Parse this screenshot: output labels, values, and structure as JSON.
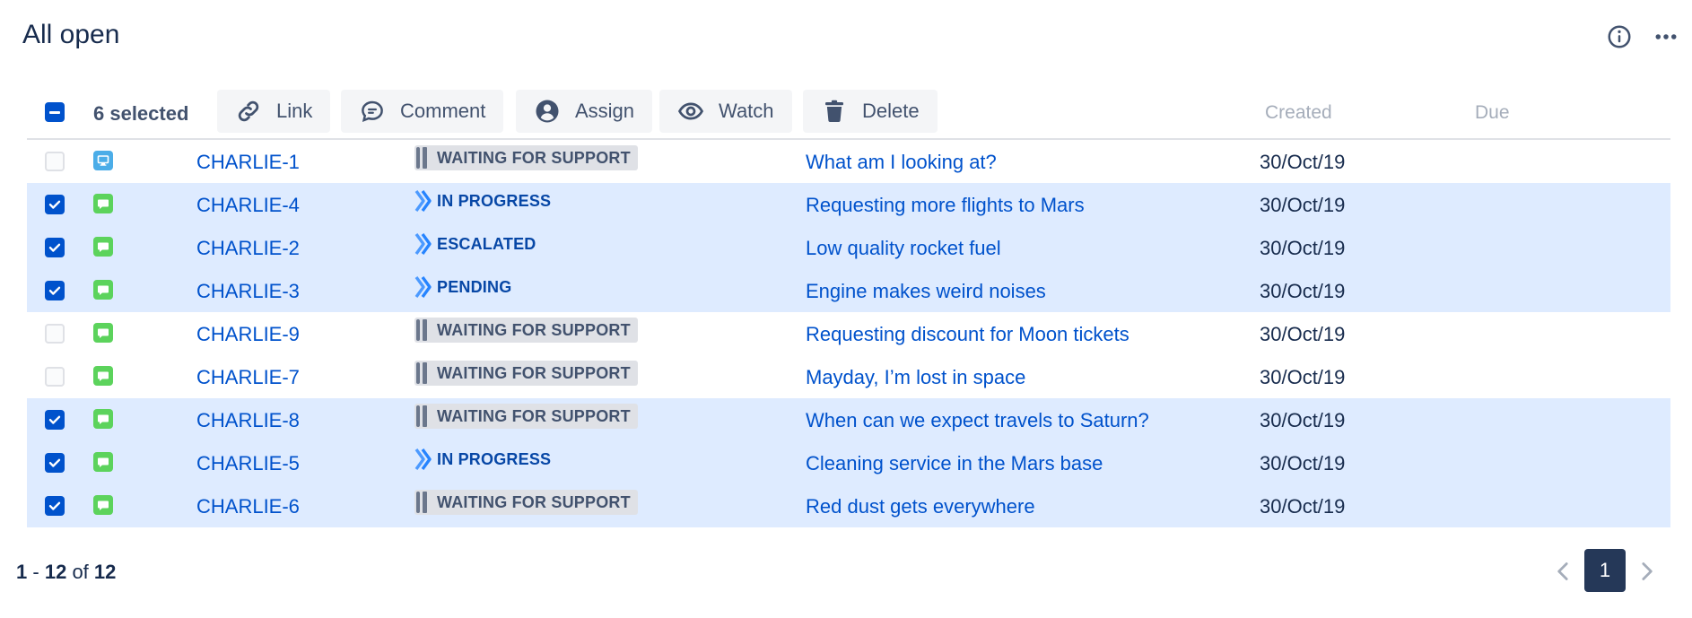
{
  "page": {
    "title": "All open"
  },
  "toolbar": {
    "selected_label": "6 selected",
    "buttons": [
      {
        "label": "Link",
        "icon": "link-icon"
      },
      {
        "label": "Comment",
        "icon": "comment-icon"
      },
      {
        "label": "Assign",
        "icon": "person-icon"
      },
      {
        "label": "Watch",
        "icon": "eye-icon"
      },
      {
        "label": "Delete",
        "icon": "trash-icon"
      }
    ],
    "columns": {
      "created": "Created",
      "due": "Due"
    }
  },
  "rows": [
    {
      "selected": false,
      "type": "change",
      "key": "CHARLIE-1",
      "status": "WAITING FOR SUPPORT",
      "status_style": "gray",
      "summary": "What am I looking at?",
      "created": "30/Oct/19"
    },
    {
      "selected": true,
      "type": "service",
      "key": "CHARLIE-4",
      "status": "IN PROGRESS",
      "status_style": "blue",
      "summary": "Requesting more flights to Mars",
      "created": "30/Oct/19"
    },
    {
      "selected": true,
      "type": "service",
      "key": "CHARLIE-2",
      "status": "ESCALATED",
      "status_style": "blue",
      "summary": "Low quality rocket fuel",
      "created": "30/Oct/19"
    },
    {
      "selected": true,
      "type": "service",
      "key": "CHARLIE-3",
      "status": "PENDING",
      "status_style": "blue",
      "summary": "Engine makes weird noises",
      "created": "30/Oct/19"
    },
    {
      "selected": false,
      "type": "service",
      "key": "CHARLIE-9",
      "status": "WAITING FOR SUPPORT",
      "status_style": "gray",
      "summary": "Requesting discount for Moon tickets",
      "created": "30/Oct/19"
    },
    {
      "selected": false,
      "type": "service",
      "key": "CHARLIE-7",
      "status": "WAITING FOR SUPPORT",
      "status_style": "gray",
      "summary": "Mayday, I’m lost in space",
      "created": "30/Oct/19"
    },
    {
      "selected": true,
      "type": "service",
      "key": "CHARLIE-8",
      "status": "WAITING FOR SUPPORT",
      "status_style": "gray",
      "summary": "When can we expect travels to Saturn?",
      "created": "30/Oct/19"
    },
    {
      "selected": true,
      "type": "service",
      "key": "CHARLIE-5",
      "status": "IN PROGRESS",
      "status_style": "blue",
      "summary": "Cleaning service in the Mars base",
      "created": "30/Oct/19"
    },
    {
      "selected": true,
      "type": "service",
      "key": "CHARLIE-6",
      "status": "WAITING FOR SUPPORT",
      "status_style": "gray",
      "summary": "Red dust gets everywhere",
      "created": "30/Oct/19"
    }
  ],
  "pagination": {
    "range_start": "1",
    "range_end": "12",
    "of_label": "of",
    "total": "12",
    "current_page": "1"
  },
  "colors": {
    "accent": "#0052cc",
    "selected_row": "#deebff",
    "pager_active": "#253858"
  }
}
